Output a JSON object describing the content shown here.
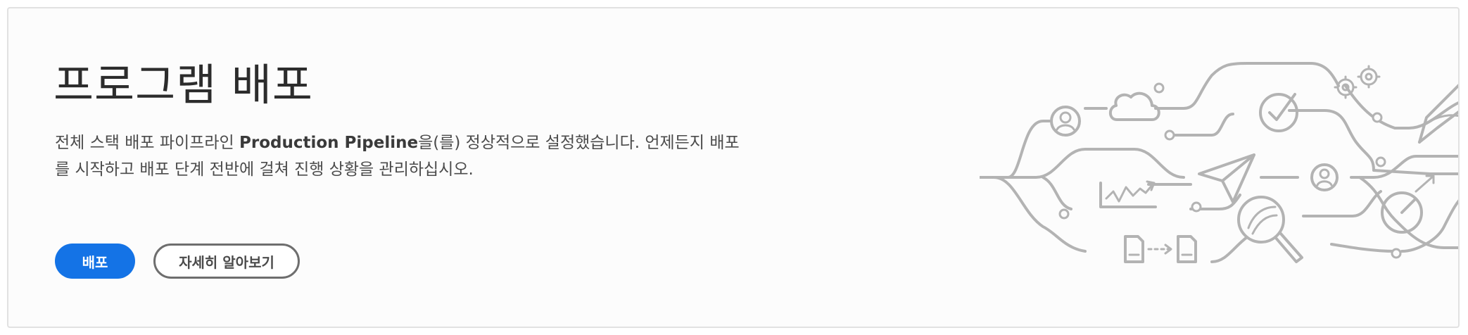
{
  "card": {
    "title": "프로그램 배포",
    "description_before": "전체 스택 배포 파이프라인 ",
    "pipeline_name": "Production Pipeline",
    "description_after": "을(를) 정상적으로 설정했습니다. 언제든지 배포를 시작하고 배포 단계 전반에 걸쳐 진행 상황을 관리하십시오.",
    "primary_button": "배포",
    "secondary_button": "자세히 알아보기"
  },
  "colors": {
    "primary": "#1473e6",
    "title_text": "#2c2c2c",
    "body_text": "#4b4b4b",
    "illustration_stroke": "#b3b3b3",
    "card_border": "#e1e1e1"
  },
  "illustration": {
    "icons": [
      "user-icon",
      "cloud-icon",
      "check-circle-icon",
      "gears-icon",
      "pen-icon",
      "paper-plane-icon",
      "chart-icon",
      "user-icon",
      "magnifier-icon",
      "gauge-icon",
      "document-icon",
      "document-icon"
    ]
  }
}
